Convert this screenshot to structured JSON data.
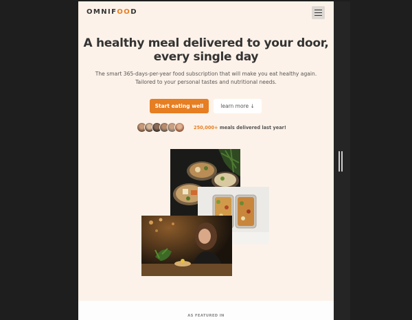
{
  "brand": {
    "logo_prefix": "OMNIF",
    "logo_oo": "OO",
    "logo_suffix": "D",
    "accent": "#e67e22"
  },
  "menu": {
    "icon": "hamburger-menu-icon"
  },
  "hero": {
    "title_line1": "A healthy meal delivered to your door,",
    "title_line2": "every single day",
    "desc_line1": "The smart 365-days-per-year food subscription that will make you eat healthy again.",
    "desc_line2": "Tailored to your personal tastes and nutritional needs.",
    "primary_button": "Start eating well",
    "secondary_button": "learn more ↓"
  },
  "delivered": {
    "count": "250,000+",
    "text": " meals delivered last year!"
  },
  "featured": {
    "label": "AS FEATURED IN"
  }
}
